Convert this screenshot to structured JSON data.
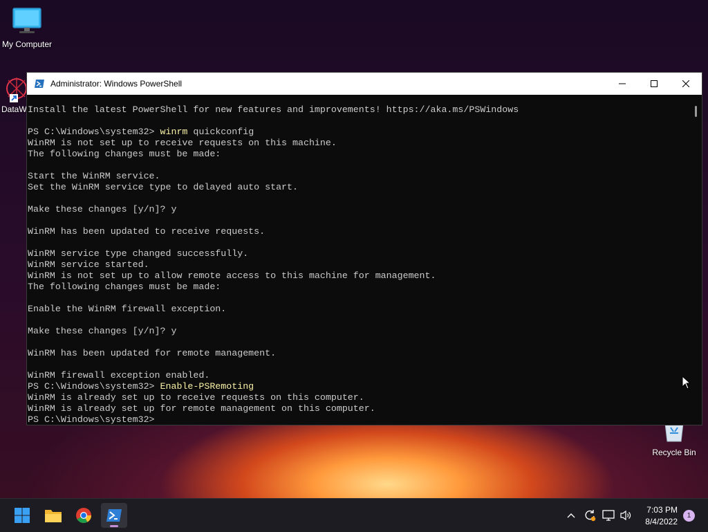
{
  "desktop": {
    "icons": [
      {
        "label": "My Computer"
      },
      {
        "label": "DataW"
      },
      {
        "label": "Recycle Bin"
      }
    ]
  },
  "window": {
    "title": "Administrator: Windows PowerShell",
    "controls": {
      "minimize": "minimize-icon",
      "maximize": "maximize-icon",
      "close": "close-icon"
    }
  },
  "console": {
    "lines": [
      {
        "text": "Install the latest PowerShell for new features and improvements! https://aka.ms/PSWindows"
      },
      {
        "text": ""
      },
      {
        "prompt": "PS C:\\Windows\\system32> ",
        "cmd": "winrm",
        "args": " quickconfig"
      },
      {
        "text": "WinRM is not set up to receive requests on this machine."
      },
      {
        "text": "The following changes must be made:"
      },
      {
        "text": ""
      },
      {
        "text": "Start the WinRM service."
      },
      {
        "text": "Set the WinRM service type to delayed auto start."
      },
      {
        "text": ""
      },
      {
        "text": "Make these changes [y/n]? y"
      },
      {
        "text": ""
      },
      {
        "text": "WinRM has been updated to receive requests."
      },
      {
        "text": ""
      },
      {
        "text": "WinRM service type changed successfully."
      },
      {
        "text": "WinRM service started."
      },
      {
        "text": "WinRM is not set up to allow remote access to this machine for management."
      },
      {
        "text": "The following changes must be made:"
      },
      {
        "text": ""
      },
      {
        "text": "Enable the WinRM firewall exception."
      },
      {
        "text": ""
      },
      {
        "text": "Make these changes [y/n]? y"
      },
      {
        "text": ""
      },
      {
        "text": "WinRM has been updated for remote management."
      },
      {
        "text": ""
      },
      {
        "text": "WinRM firewall exception enabled."
      },
      {
        "prompt": "PS C:\\Windows\\system32> ",
        "cmd": "Enable-PSRemoting",
        "args": ""
      },
      {
        "text": "WinRM is already set up to receive requests on this computer."
      },
      {
        "text": "WinRM is already set up for remote management on this computer."
      },
      {
        "prompt": "PS C:\\Windows\\system32> ",
        "cmd": "",
        "args": ""
      }
    ]
  },
  "taskbar": {
    "apps": [
      "windows-start-icon",
      "file-explorer-icon",
      "chrome-icon",
      "powershell-icon"
    ],
    "tray": [
      "chevron-up-icon",
      "update-sync-icon",
      "network-icon",
      "volume-icon"
    ],
    "time": "7:03 PM",
    "date": "8/4/2022",
    "notification_count": "1"
  },
  "colors": {
    "console_bg": "#0c0c0c",
    "console_text": "#cccccc",
    "command_text": "#f9f1a5",
    "taskbar_bg": "#1c1c22"
  }
}
